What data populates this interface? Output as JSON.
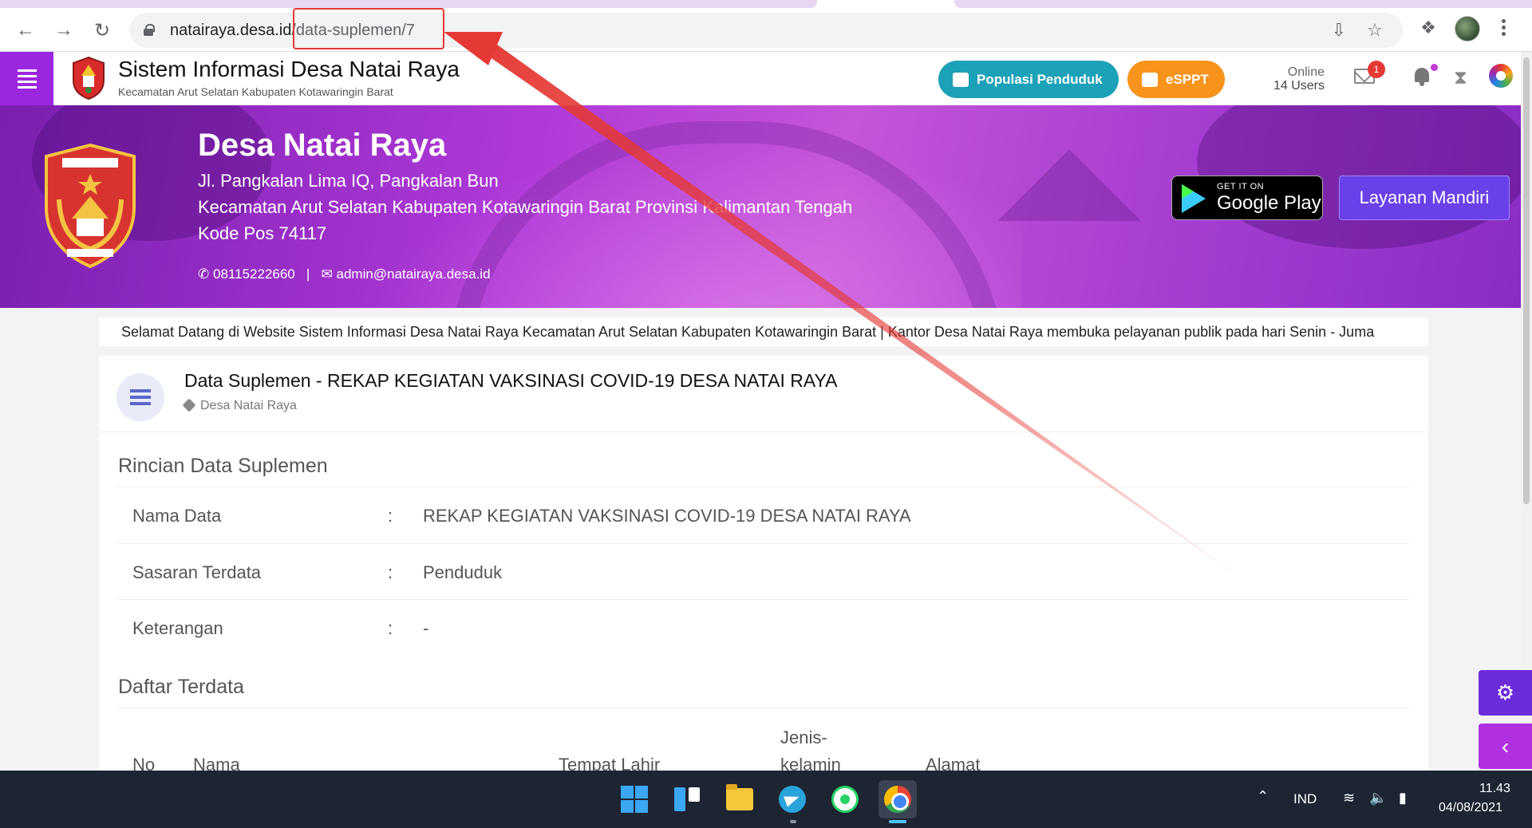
{
  "browser": {
    "url_host": "natairaya.desa.id",
    "url_path": "/data-suplemen/7"
  },
  "header": {
    "title": "Sistem Informasi Desa Natai Raya",
    "subtitle": "Kecamatan Arut Selatan  Kabupaten Kotawaringin Barat",
    "btn_populasi": "Populasi Penduduk",
    "btn_esppt": "eSPPT",
    "online_label": "Online",
    "online_users": "14 Users",
    "mail_badge": "1"
  },
  "banner": {
    "desa_name": "Desa Natai Raya",
    "address_line1": "Jl. Pangkalan Lima IQ, Pangkalan Bun",
    "address_line2": "Kecamatan Arut Selatan Kabupaten Kotawaringin Barat Provinsi Kalimantan Tengah",
    "address_line3": "Kode Pos 74117",
    "phone": "08115222660",
    "email": "admin@natairaya.desa.id",
    "gplay_small": "GET IT ON",
    "gplay_big": "Google Play",
    "layanan": "Layanan Mandiri"
  },
  "marquee": "Selamat Datang di Website Sistem Informasi Desa Natai Raya Kecamatan Arut Selatan Kabupaten Kotawaringin Barat | Kantor Desa Natai Raya membuka pelayanan publik pada hari Senin - Juma",
  "card": {
    "title": "Data Suplemen - REKAP KEGIATAN VAKSINASI COVID-19 DESA NATAI RAYA",
    "tag": "Desa Natai Raya",
    "section_rincian": "Rincian Data Suplemen",
    "rows": [
      {
        "label": "Nama Data",
        "value": "REKAP KEGIATAN VAKSINASI COVID-19 DESA NATAI RAYA"
      },
      {
        "label": "Sasaran Terdata",
        "value": "Penduduk"
      },
      {
        "label": "Keterangan",
        "value": "-"
      }
    ],
    "colon": ":",
    "section_daftar": "Daftar Terdata",
    "table_headers": {
      "no": "No",
      "nama": "Nama",
      "tempat_lahir": "Tempat Lahir",
      "jenis_kelamin_1": "Jenis-",
      "jenis_kelamin_2": "kelamin",
      "alamat": "Alamat"
    }
  },
  "taskbar": {
    "lang": "IND",
    "time": "11.43",
    "date": "04/08/2021"
  },
  "colors": {
    "accent_purple": "#9c27e0",
    "teal_button": "#1ca2b8",
    "orange_button": "#f8941c",
    "annotation_red": "#e53935"
  }
}
